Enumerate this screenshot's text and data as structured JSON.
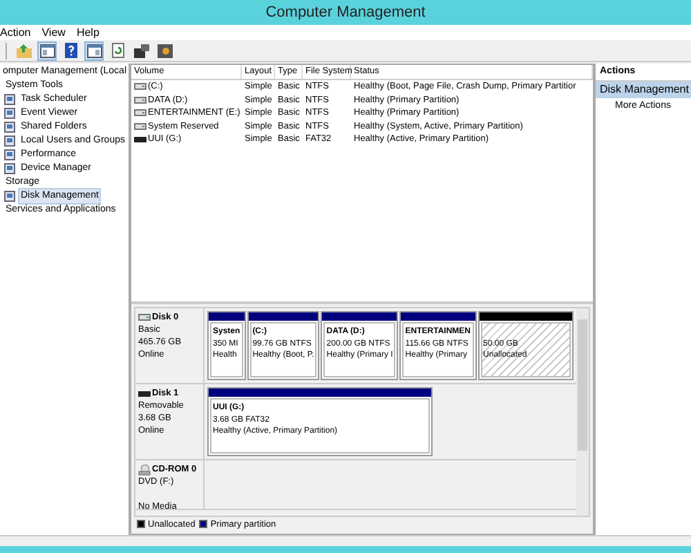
{
  "window": {
    "title": "Computer Management"
  },
  "menu": [
    "Action",
    "View",
    "Help"
  ],
  "toolbar": [
    {
      "kind": "up",
      "pressed": false
    },
    {
      "kind": "tree",
      "pressed": true
    },
    {
      "kind": "help",
      "pressed": false
    },
    {
      "kind": "pane",
      "pressed": true
    },
    {
      "kind": "refresh",
      "pressed": false
    },
    {
      "kind": "export",
      "pressed": false
    },
    {
      "kind": "settings",
      "pressed": false
    }
  ],
  "tree": [
    {
      "label": "omputer Management (Local",
      "selected": false,
      "children": [
        {
          "label": "System Tools",
          "selected": false,
          "children": [
            {
              "label": "Task Scheduler",
              "selected": false
            },
            {
              "label": "Event Viewer",
              "selected": false
            },
            {
              "label": "Shared Folders",
              "selected": false
            },
            {
              "label": "Local Users and Groups",
              "selected": false
            },
            {
              "label": "Performance",
              "selected": false
            },
            {
              "label": "Device Manager",
              "selected": false
            }
          ]
        },
        {
          "label": "Storage",
          "selected": false,
          "children": [
            {
              "label": "Disk Management",
              "selected": true
            }
          ]
        },
        {
          "label": "Services and Applications",
          "selected": false
        }
      ]
    }
  ],
  "volumes": {
    "columns": [
      "Volume",
      "Layout",
      "Type",
      "File System",
      "Status"
    ],
    "rows": [
      {
        "kind": "disk",
        "cells": [
          "(C:)",
          "Simple",
          "Basic",
          "NTFS",
          "Healthy (Boot, Page File, Crash Dump, Primary Partitior"
        ]
      },
      {
        "kind": "disk",
        "cells": [
          "DATA (D:)",
          "Simple",
          "Basic",
          "NTFS",
          "Healthy (Primary Partition)"
        ]
      },
      {
        "kind": "disk",
        "cells": [
          "ENTERTAINMENT (E:)",
          "Simple",
          "Basic",
          "NTFS",
          "Healthy (Primary Partition)"
        ]
      },
      {
        "kind": "disk",
        "cells": [
          "System Reserved",
          "Simple",
          "Basic",
          "NTFS",
          "Healthy (System, Active, Primary Partition)"
        ]
      },
      {
        "kind": "removable",
        "cells": [
          "UUI (G:)",
          "Simple",
          "Basic",
          "FAT32",
          "Healthy (Active, Primary Partition)"
        ]
      }
    ]
  },
  "disks": [
    {
      "kind": "disk",
      "name": "Disk 0",
      "info": [
        "Basic",
        "465.76 GB",
        "Online"
      ],
      "partitions": [
        {
          "kind": "primary",
          "lines": [
            "Systen",
            "350 MI",
            "Health"
          ]
        },
        {
          "kind": "primary",
          "lines": [
            "(C:)",
            "99.76 GB NTFS",
            "Healthy (Boot, P."
          ]
        },
        {
          "kind": "primary",
          "lines": [
            "DATA  (D:)",
            "200.00 GB NTFS",
            "Healthy (Primary I"
          ]
        },
        {
          "kind": "primary",
          "lines": [
            "ENTERTAINMEN",
            "115.66 GB NTFS",
            "Healthy (Primary"
          ]
        },
        {
          "kind": "unallocated",
          "lines": [
            "50.00 GB",
            "Unallocated"
          ]
        }
      ]
    },
    {
      "kind": "removable",
      "name": "Disk 1",
      "info": [
        "Removable",
        "3.68 GB",
        "Online"
      ],
      "partitions": [
        {
          "kind": "primary",
          "lines": [
            "UUI  (G:)",
            "3.68 GB FAT32",
            "Healthy (Active, Primary Partition)"
          ]
        }
      ]
    },
    {
      "kind": "cdrom",
      "name": "CD-ROM 0",
      "info": [
        "DVD (F:)",
        "No Media"
      ]
    }
  ],
  "legend": [
    {
      "label": "Unallocated",
      "color": "#000000"
    },
    {
      "label": "Primary partition",
      "color": "#00007f"
    }
  ],
  "actions": {
    "title": "Actions",
    "section": "Disk Management",
    "items": [
      "More Actions"
    ]
  }
}
